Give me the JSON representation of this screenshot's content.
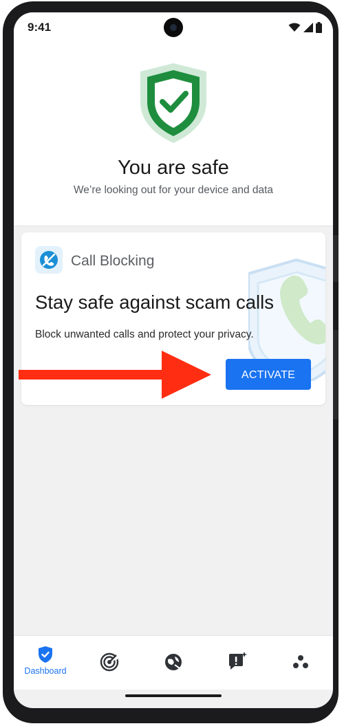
{
  "status_bar": {
    "time": "9:41",
    "icons": [
      "wifi-icon",
      "signal-icon",
      "battery-icon"
    ]
  },
  "hero": {
    "icon": "shield-check-icon",
    "title": "You are safe",
    "subtitle": "We’re looking out for your device and data"
  },
  "card": {
    "icon": "call-blocking-icon",
    "service_name": "Call Blocking",
    "title": "Stay safe against scam calls",
    "description": "Block unwanted calls and protect your privacy.",
    "button_label": "ACTIVATE",
    "background_icon": "phone-shield-icon"
  },
  "annotation": {
    "icon": "red-arrow-icon",
    "color": "#ff2d12"
  },
  "bottom_nav": {
    "items": [
      {
        "label": "Dashboard",
        "icon": "shield-check-icon",
        "active": true
      },
      {
        "label": "",
        "icon": "scan-icon",
        "active": false
      },
      {
        "label": "",
        "icon": "web-protection-icon",
        "active": false
      },
      {
        "label": "",
        "icon": "alert-sparkle-icon",
        "active": false
      },
      {
        "label": "",
        "icon": "more-dots-icon",
        "active": false
      }
    ]
  },
  "colors": {
    "accent": "#1a73f0",
    "shield_green": "#1e8e3e",
    "shield_light": "#cfe9d6",
    "screen_bg": "#f1f1f2"
  }
}
